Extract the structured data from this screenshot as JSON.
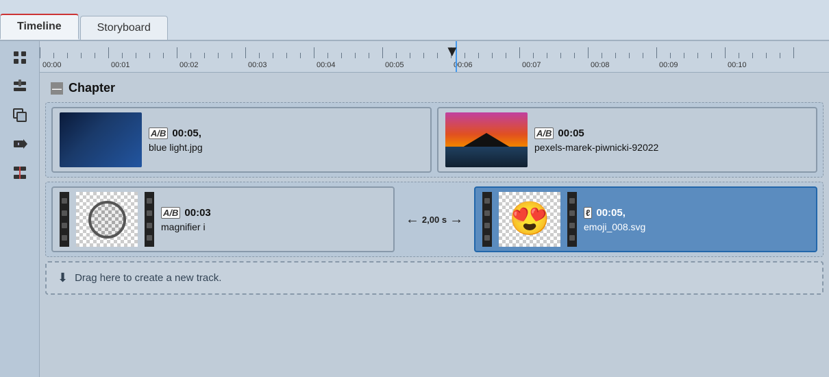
{
  "tabs": [
    {
      "id": "timeline",
      "label": "Timeline",
      "active": true
    },
    {
      "id": "storyboard",
      "label": "Storyboard",
      "active": false
    }
  ],
  "toolbar": {
    "tools": [
      {
        "name": "multi-tool",
        "icon": "⊞"
      },
      {
        "name": "add-track-tool",
        "icon": "⊕"
      },
      {
        "name": "duplicate-tool",
        "icon": "❐"
      },
      {
        "name": "arrow-tool",
        "icon": "⊳"
      },
      {
        "name": "trim-tool",
        "icon": "✂"
      }
    ]
  },
  "ruler": {
    "times": [
      "00:00",
      "00:01",
      "00:02",
      "00:03",
      "00:04",
      "00:05",
      "00:06",
      "00:07",
      "00:08",
      "00:09",
      "00:10"
    ]
  },
  "chapter": {
    "label": "Chapter"
  },
  "tracks": [
    {
      "id": "track-images",
      "clips": [
        {
          "id": "clip-blue",
          "thumbnail_type": "blue",
          "ab_icon": "A/B",
          "time": "00:05,",
          "name": "blue light.jpg",
          "selected": false
        },
        {
          "id": "clip-sunset",
          "thumbnail_type": "sunset",
          "ab_icon": "A/B",
          "time": "00:05",
          "name": "pexels-marek-piwnicki-92022",
          "selected": false
        }
      ]
    },
    {
      "id": "track-animations",
      "clips": [
        {
          "id": "clip-magnifier",
          "thumbnail_type": "magnifier",
          "ab_icon": "A/B",
          "time": "00:03",
          "name": "magnifier i",
          "selected": false
        },
        {
          "id": "clip-emoji",
          "thumbnail_type": "emoji",
          "ab_icon": "ℓ",
          "time": "00:05,",
          "name": "emoji_008.svg",
          "selected": true
        }
      ],
      "transition": {
        "duration": "2,00 s"
      }
    }
  ],
  "drag_zone": {
    "label": "Drag here to create a new track.",
    "icon": "⬇"
  },
  "playhead": {
    "position_percent": 57
  }
}
